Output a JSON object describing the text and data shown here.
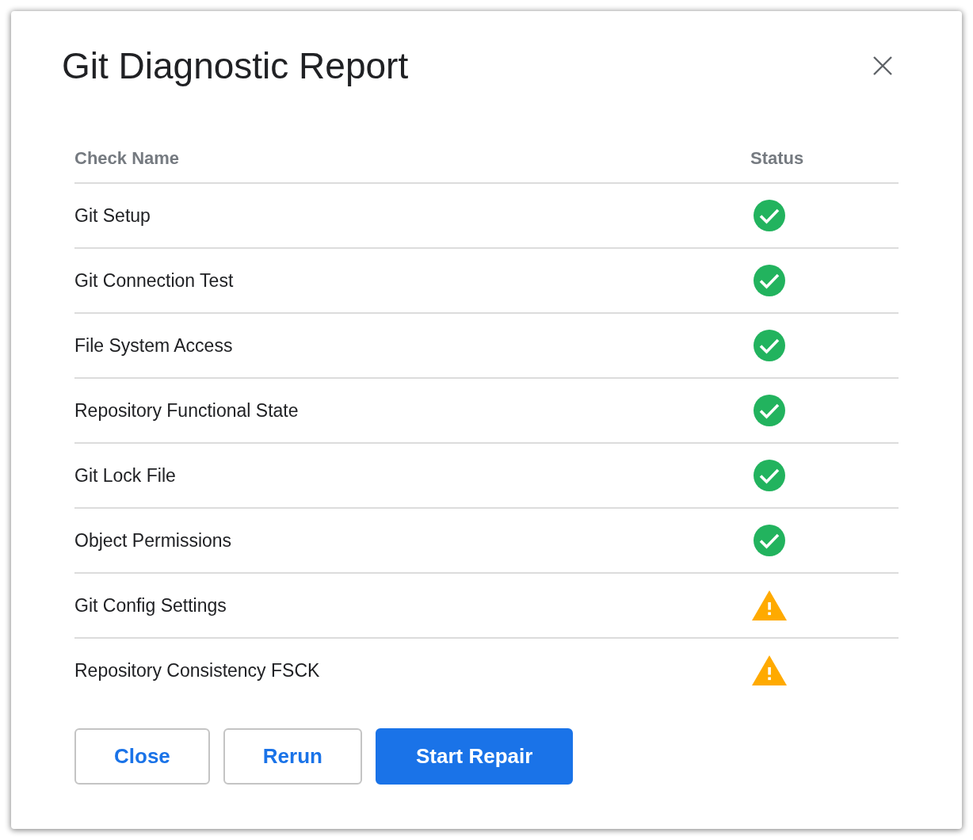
{
  "dialog": {
    "title": "Git Diagnostic Report"
  },
  "table": {
    "columns": [
      "Check Name",
      "Status"
    ],
    "rows": [
      {
        "name": "Git Setup",
        "passed": true
      },
      {
        "name": "Git Connection Test",
        "passed": true
      },
      {
        "name": "File System Access",
        "passed": true
      },
      {
        "name": "Repository Functional State",
        "passed": true
      },
      {
        "name": "Git Lock File",
        "passed": true
      },
      {
        "name": "Object Permissions",
        "passed": true
      },
      {
        "name": "Git Config Settings",
        "passed": false
      },
      {
        "name": "Repository Consistency FSCK",
        "passed": false
      }
    ]
  },
  "buttons": [
    {
      "label": "Close",
      "kind": "secondary"
    },
    {
      "label": "Rerun",
      "kind": "secondary"
    },
    {
      "label": "Start Repair",
      "kind": "primary"
    }
  ]
}
